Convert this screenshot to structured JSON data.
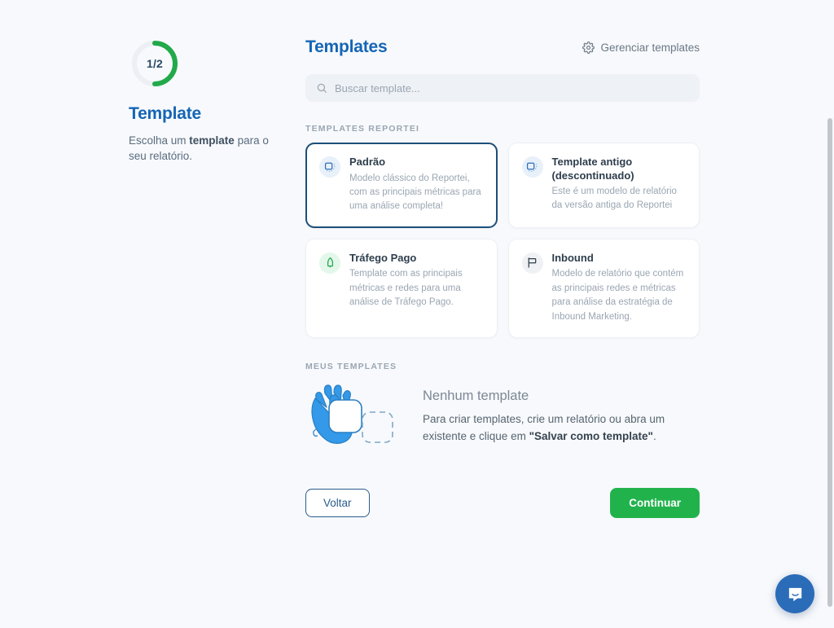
{
  "step": {
    "progress_label": "1/2",
    "progress_current": 1,
    "progress_total": 2,
    "title": "Template",
    "description_before": "Escolha um ",
    "description_bold": "template",
    "description_after": " para o seu relatório.",
    "ring_color": "#22a94a",
    "ring_track_color": "#eceff3"
  },
  "header": {
    "title": "Templates",
    "manage_label": "Gerenciar templates",
    "gear_icon": "gear-icon",
    "title_color": "#1565b5"
  },
  "search": {
    "placeholder": "Buscar template...",
    "value": "",
    "icon": "search-icon"
  },
  "sections": {
    "reportei_label": "TEMPLATES REPORTEI",
    "mine_label": "MEUS TEMPLATES"
  },
  "templates": [
    {
      "name": "Padrão",
      "description": "Modelo clássico do Reportei, com as principais métricas para uma análise completa!",
      "icon": "monitor-dots-icon",
      "icon_style": "blue",
      "selected": true
    },
    {
      "name": "Template antigo (descontinuado)",
      "description": "Este é um modelo de relatório da versão antiga do Reportei",
      "icon": "monitor-dots-icon",
      "icon_style": "blue",
      "selected": false
    },
    {
      "name": "Tráfego Pago",
      "description": "Template com as principais métricas e redes para uma análise de Tráfego Pago.",
      "icon": "rocket-icon",
      "icon_style": "green",
      "selected": false
    },
    {
      "name": "Inbound",
      "description": "Modelo de relatório que contém as principais redes e métricas para análise da estratégia de Inbound Marketing.",
      "icon": "flag-icon",
      "icon_style": "gray",
      "selected": false
    }
  ],
  "empty_state": {
    "illustration": "hand-holding-card-illustration",
    "title": "Nenhum template",
    "text_before": "Para criar templates, crie um relatório ou abra um existente e clique em ",
    "text_bold": "\"Salvar como template\"",
    "text_after": "."
  },
  "footer": {
    "back_label": "Voltar",
    "next_label": "Continuar",
    "next_color": "#22b24c",
    "back_color": "#2a5c8e"
  },
  "chat": {
    "icon": "chat-bubble-icon",
    "color": "#2b6cb8"
  }
}
